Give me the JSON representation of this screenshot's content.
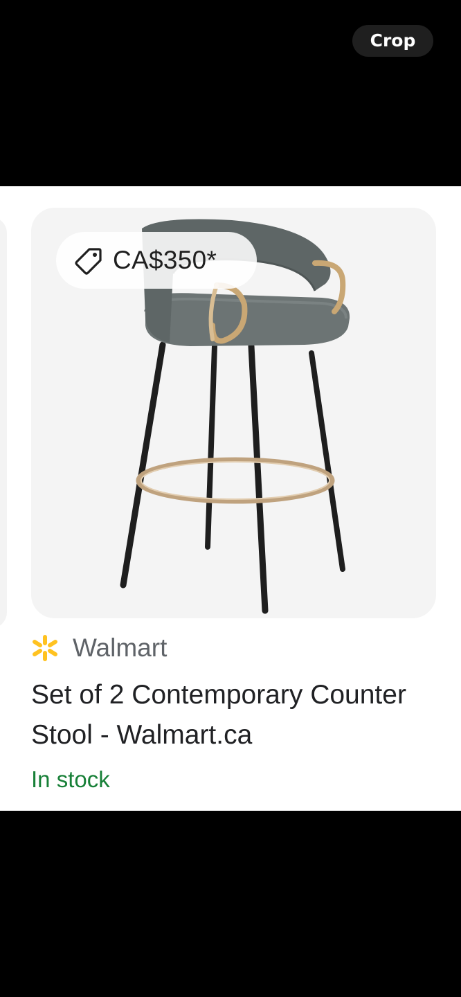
{
  "toolbar": {
    "crop_label": "Crop"
  },
  "product": {
    "price": "CA$350*",
    "price_icon": "price-tag-icon",
    "merchant": {
      "name": "Walmart",
      "logo_icon": "walmart-spark-icon",
      "logo_color": "#ffc220"
    },
    "title": "Set of 2 Contemporary Counter Stool - Walmart.ca",
    "availability": "In stock",
    "availability_color": "#188038",
    "image": "counter-stool-image"
  }
}
